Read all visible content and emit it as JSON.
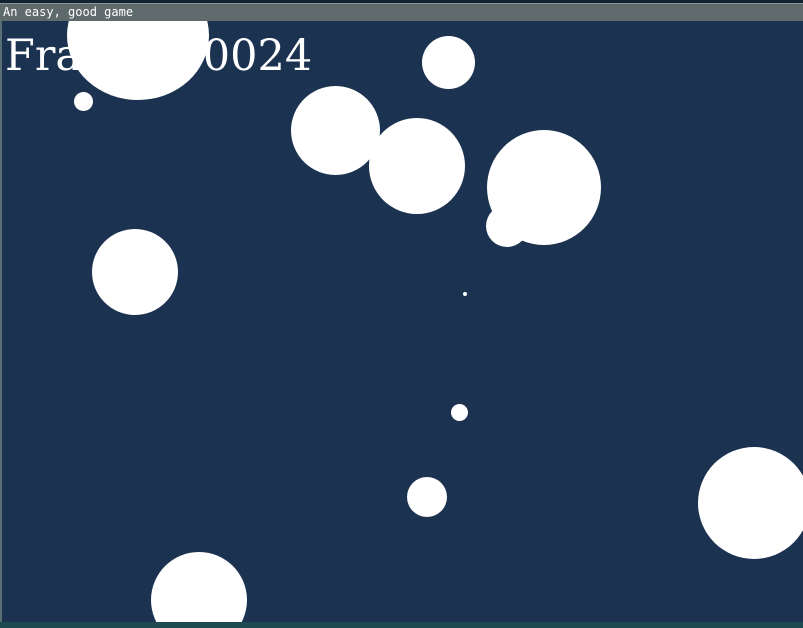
{
  "window": {
    "title": "An easy, good game"
  },
  "hud": {
    "frame_label": "Frame: 00024"
  },
  "colors": {
    "background": "#1b3250",
    "titlebar": "#5f6a6d",
    "ball": "#ffffff",
    "text": "#ffffff"
  }
}
